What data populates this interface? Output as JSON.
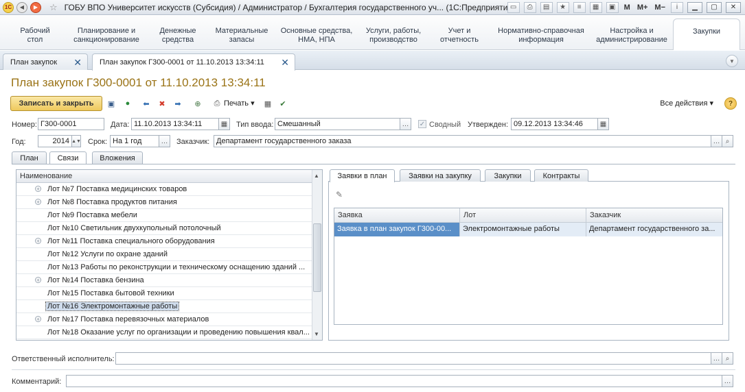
{
  "window": {
    "title": "ГОБУ ВПО Университет искусств (Субсидия) / Администратор / Бухгалтерия государственного уч...  (1С:Предприятие)",
    "tool_m": "M",
    "tool_mplus": "M+",
    "tool_mminus": "M−"
  },
  "sections": [
    {
      "label": "Рабочий\nстол"
    },
    {
      "label": "Планирование и\nсанкционирование"
    },
    {
      "label": "Денежные\nсредства"
    },
    {
      "label": "Материальные\nзапасы"
    },
    {
      "label": "Основные средства,\nНМА, НПА"
    },
    {
      "label": "Услуги, работы,\nпроизводство"
    },
    {
      "label": "Учет и\nотчетность"
    },
    {
      "label": "Нормативно-справочная\nинформация"
    },
    {
      "label": "Настройка и\nадминистрирование"
    },
    {
      "label": "Закупки"
    }
  ],
  "doc_tabs": [
    {
      "label": "План закупок"
    },
    {
      "label": "План закупок Г300-0001 от 11.10.2013 13:34:11"
    }
  ],
  "page_title": "План закупок Г300-0001 от 11.10.2013 13:34:11",
  "toolbar": {
    "save_close": "Записать и закрыть",
    "print": "Печать",
    "all_actions": "Все действия",
    "help": "?"
  },
  "form": {
    "number_label": "Номер:",
    "number_value": "Г300-0001",
    "date_label": "Дата:",
    "date_value": "11.10.2013 13:34:11",
    "input_type_label": "Тип ввода:",
    "input_type_value": "Смешанный",
    "summary_label": "Сводный",
    "approved_label": "Утвержден:",
    "approved_value": "09.12.2013 13:34:46",
    "year_label": "Год:",
    "year_value": "2014",
    "term_label": "Срок:",
    "term_value": "На 1 год",
    "customer_label": "Заказчик:",
    "customer_value": "Департамент государственного заказа",
    "responsible_label": "Ответственный исполнитель:",
    "responsible_value": "",
    "comment_label": "Комментарий:",
    "comment_value": ""
  },
  "inner_tabs": [
    {
      "label": "План"
    },
    {
      "label": "Связи"
    },
    {
      "label": "Вложения"
    }
  ],
  "tree": {
    "header": "Наименование",
    "rows": [
      {
        "label": "Лот №7 Поставка медицинских товаров",
        "expandable": true
      },
      {
        "label": "Лот №8 Поставка продуктов питания",
        "expandable": true
      },
      {
        "label": "Лот №9 Поставка мебели",
        "expandable": false
      },
      {
        "label": "Лот №10 Светильник двухкупольный потолочный",
        "expandable": false
      },
      {
        "label": "Лот №11 Поставка специального оборудования",
        "expandable": true
      },
      {
        "label": "Лот №12 Услуги по охране зданий",
        "expandable": false
      },
      {
        "label": "Лот №13 Работы по реконструкции и техническому оснащению зданий ...",
        "expandable": false
      },
      {
        "label": "Лот №14 Поставка бензина",
        "expandable": true
      },
      {
        "label": "Лот №15 Поставка бытовой техники",
        "expandable": false
      },
      {
        "label": "Лот №16 Электромонтажные работы",
        "expandable": false,
        "selected": true
      },
      {
        "label": "Лот №17 Поставка перевязочных материалов",
        "expandable": true
      },
      {
        "label": "Лот №18 Оказание услуг по организации и проведению повышения квал...",
        "expandable": false
      }
    ]
  },
  "right_tabs": [
    {
      "label": "Заявки в план"
    },
    {
      "label": "Заявки на закупку"
    },
    {
      "label": "Закупки"
    },
    {
      "label": "Контракты"
    }
  ],
  "grid": {
    "headers": [
      "Заявка",
      "Лот",
      "Заказчик"
    ],
    "rows": [
      [
        "Заявка в план закупок Г300-00...",
        "Электромонтажные работы",
        "Департамент государственного за..."
      ]
    ]
  }
}
